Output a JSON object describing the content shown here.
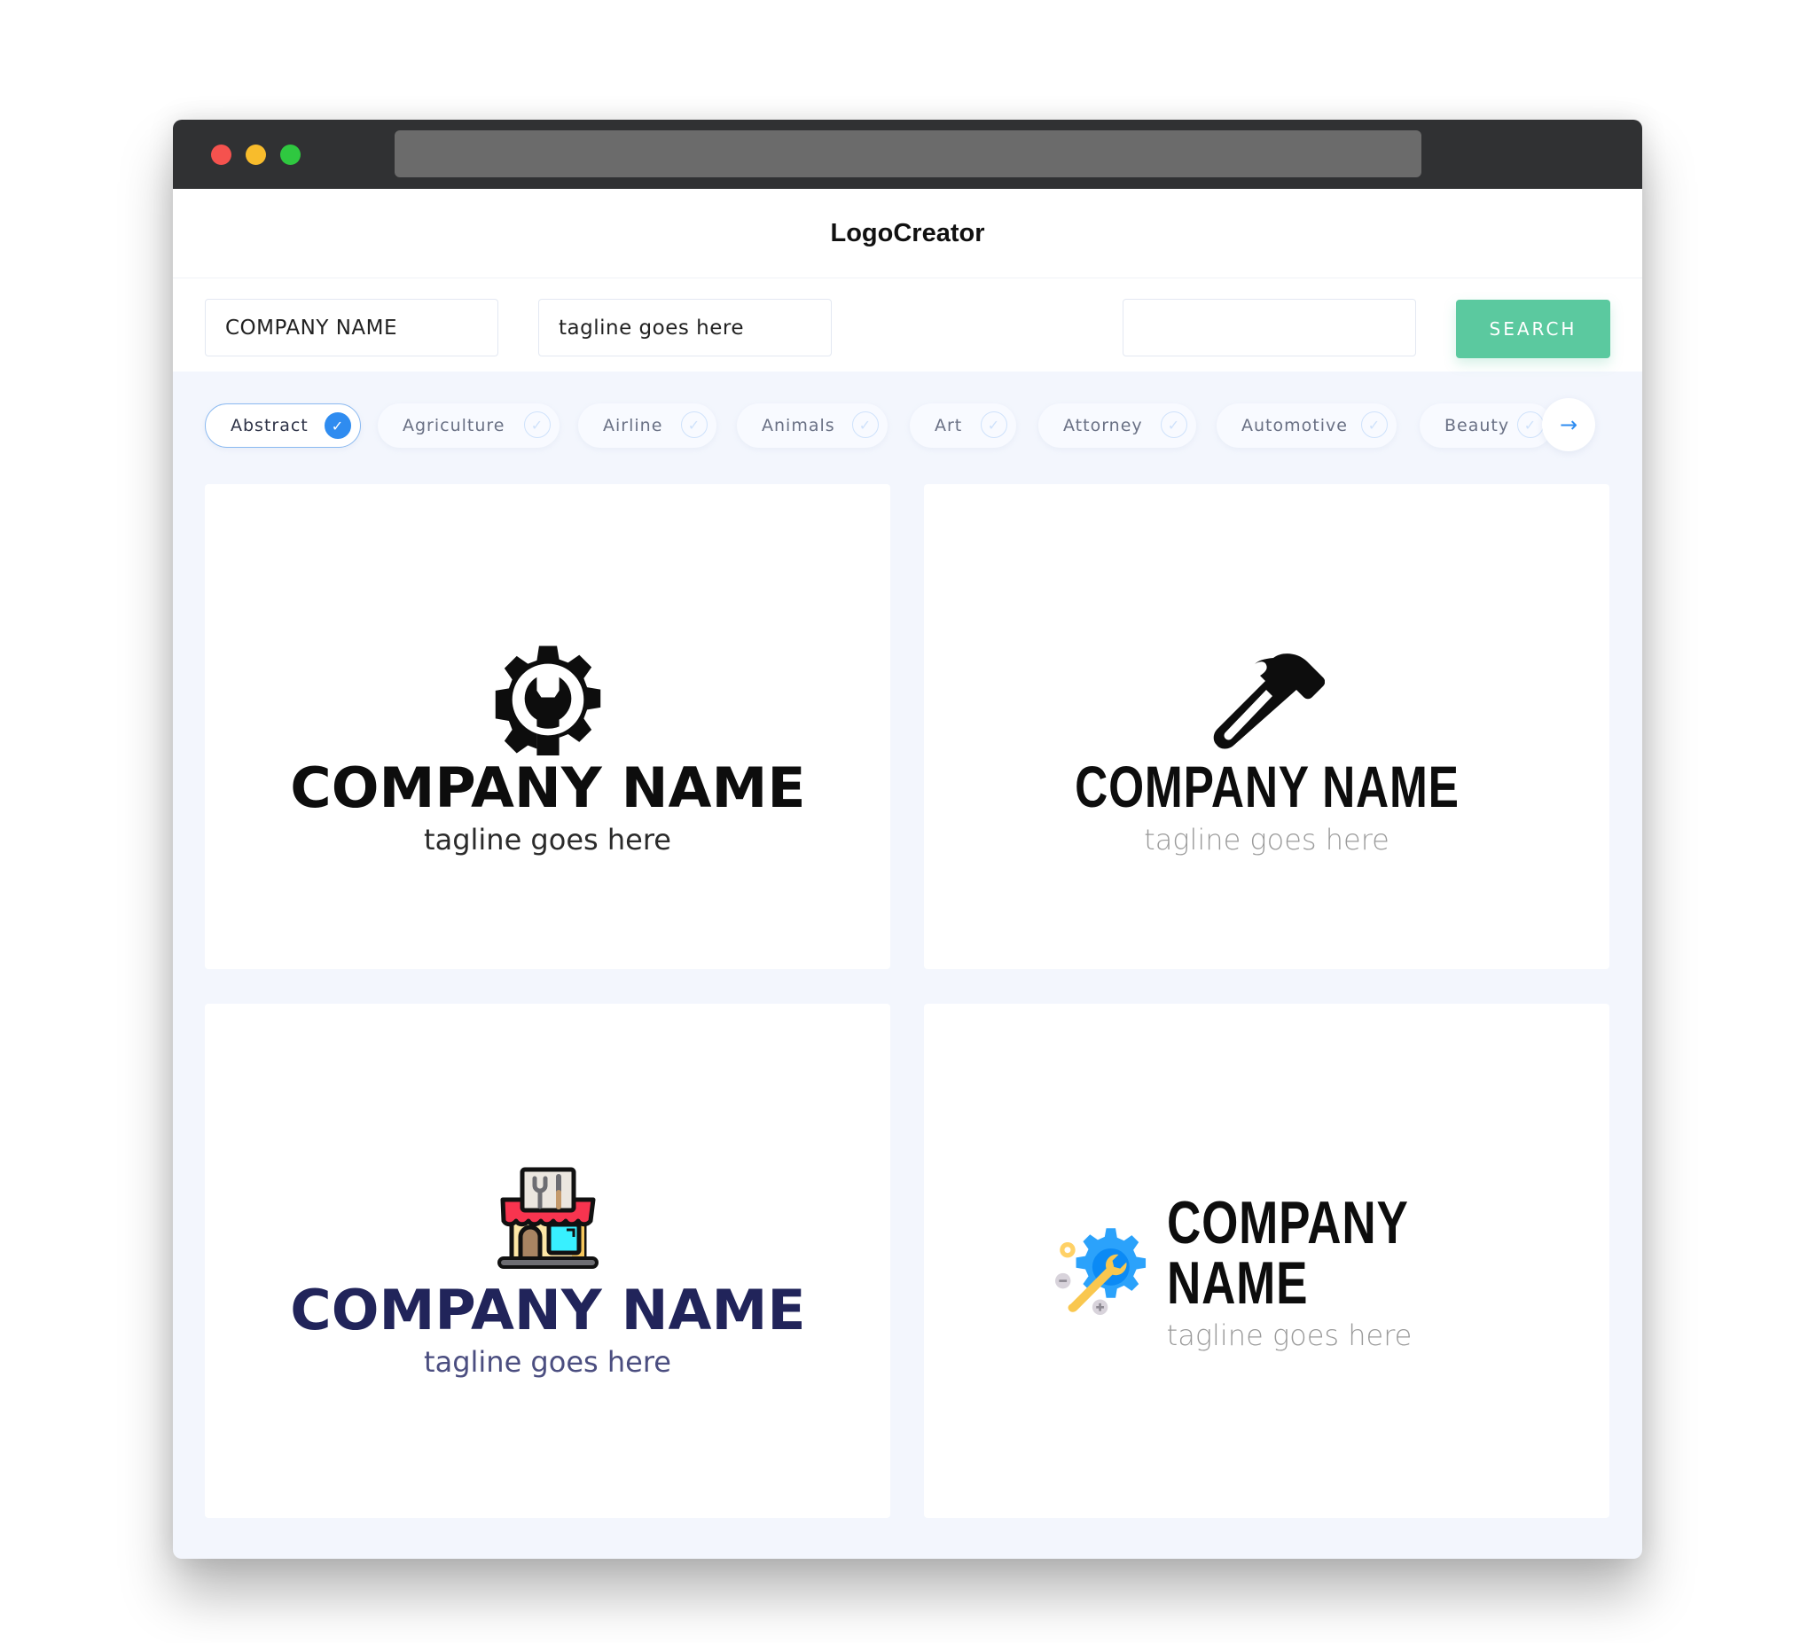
{
  "window": {
    "traffic_lights": [
      "close",
      "minimize",
      "maximize"
    ],
    "url": ""
  },
  "header": {
    "title": "LogoCreator"
  },
  "search": {
    "company_name_value": "COMPANY NAME",
    "tagline_value": "tagline goes here",
    "keyword_value": "",
    "search_button": "SEARCH"
  },
  "categories": {
    "items": [
      {
        "label": "Abstract",
        "selected": true
      },
      {
        "label": "Agriculture",
        "selected": false
      },
      {
        "label": "Airline",
        "selected": false
      },
      {
        "label": "Animals",
        "selected": false
      },
      {
        "label": "Art",
        "selected": false
      },
      {
        "label": "Attorney",
        "selected": false
      },
      {
        "label": "Automotive",
        "selected": false
      },
      {
        "label": "Beauty",
        "selected": false
      }
    ],
    "next_icon": "arrow-right"
  },
  "logos": [
    {
      "icon": "gear-wrench-icon",
      "company": "COMPANY NAME",
      "tagline": "tagline goes here",
      "colors": {
        "name": "#0d0d0d",
        "tagline": "#2b2b2b"
      }
    },
    {
      "icon": "hammer-icon",
      "company": "COMPANY NAME",
      "tagline": "tagline goes here",
      "colors": {
        "name": "#0d0d0d",
        "tagline": "#9a9a9a"
      }
    },
    {
      "icon": "repair-shop-icon",
      "company": "COMPANY NAME",
      "tagline": "tagline goes here",
      "colors": {
        "name": "#21245a",
        "tagline": "#4b4e80"
      }
    },
    {
      "icon": "blue-gear-wrench-icon",
      "company": "COMPANY NAME",
      "tagline": "tagline goes here",
      "colors": {
        "name": "#0d0d0d",
        "tagline": "#9a9a9a"
      }
    }
  ],
  "colors": {
    "accent": "#2f8cf0",
    "search_button": "#5bc99f",
    "titlebar": "#303133",
    "page_bg": "#f3f6fd"
  }
}
